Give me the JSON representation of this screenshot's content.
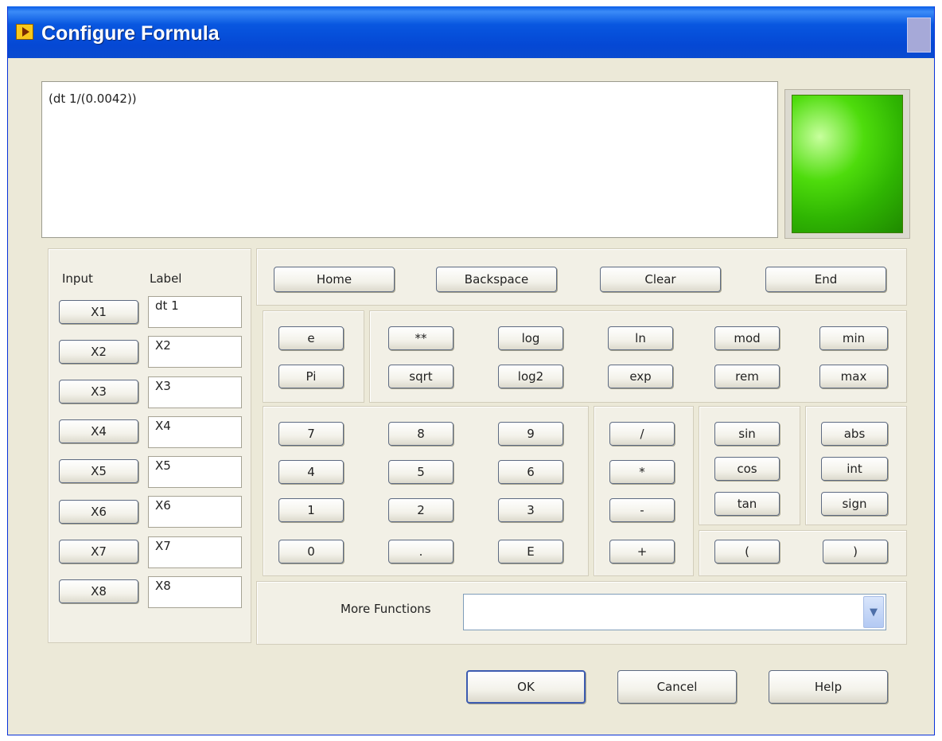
{
  "window": {
    "title": "Configure Formula"
  },
  "formula": {
    "text": "(dt 1/(0.0042))"
  },
  "inputs": {
    "header_input": "Input",
    "header_label": "Label",
    "rows": [
      {
        "button": "X1",
        "label": "dt 1"
      },
      {
        "button": "X2",
        "label": "X2"
      },
      {
        "button": "X3",
        "label": "X3"
      },
      {
        "button": "X4",
        "label": "X4"
      },
      {
        "button": "X5",
        "label": "X5"
      },
      {
        "button": "X6",
        "label": "X6"
      },
      {
        "button": "X7",
        "label": "X7"
      },
      {
        "button": "X8",
        "label": "X8"
      }
    ]
  },
  "nav": {
    "home": "Home",
    "backspace": "Backspace",
    "clear": "Clear",
    "end": "End"
  },
  "constants": {
    "e": "e",
    "pi": "Pi"
  },
  "functions": {
    "pow": "**",
    "log": "log",
    "ln": "ln",
    "mod": "mod",
    "min": "min",
    "sqrt": "sqrt",
    "log2": "log2",
    "exp": "exp",
    "rem": "rem",
    "max": "max"
  },
  "digits": {
    "d7": "7",
    "d8": "8",
    "d9": "9",
    "d4": "4",
    "d5": "5",
    "d6": "6",
    "d1": "1",
    "d2": "2",
    "d3": "3",
    "d0": "0",
    "dot": ".",
    "E": "E"
  },
  "operators": {
    "div": "/",
    "mul": "*",
    "sub": "-",
    "add": "+"
  },
  "trig": {
    "sin": "sin",
    "cos": "cos",
    "tan": "tan"
  },
  "misc": {
    "abs": "abs",
    "int": "int",
    "sign": "sign"
  },
  "parens": {
    "open": "(",
    "close": ")"
  },
  "more_functions": {
    "label": "More Functions",
    "value": ""
  },
  "footer": {
    "ok": "OK",
    "cancel": "Cancel",
    "help": "Help"
  },
  "colors": {
    "led": "#2fb502",
    "titlebar": "#0548d4",
    "panel": "#f2f0e6"
  },
  "icons": {
    "title": "labview-icon",
    "dropdown": "chevron-down-icon"
  }
}
